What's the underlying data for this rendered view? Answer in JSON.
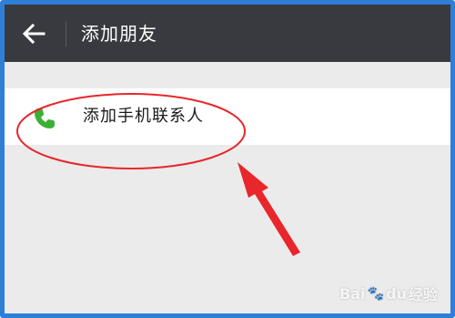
{
  "header": {
    "title": "添加朋友",
    "back_icon": "arrow-left-icon"
  },
  "list": {
    "items": [
      {
        "label": "添加手机联系人",
        "icon": "phone-icon",
        "icon_color": "#3cb034"
      }
    ]
  },
  "annotation": {
    "color": "#e8262b"
  },
  "watermark": {
    "text_a": "Bai",
    "text_b": "经验",
    "text_c": "du"
  }
}
